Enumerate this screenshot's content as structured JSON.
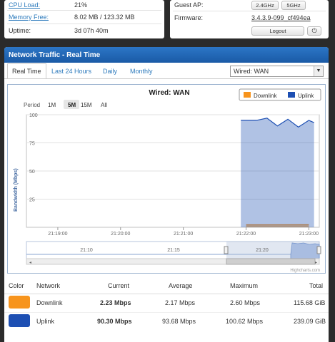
{
  "system": {
    "cpu_label": "CPU Load:",
    "cpu_value": "21%",
    "mem_label": "Memory Free:",
    "mem_value": "8.02 MB / 123.32 MB",
    "uptime_label": "Uptime:",
    "uptime_value": "3d 07h 40m"
  },
  "network": {
    "guest_label": "Guest AP:",
    "btn_24": "2.4GHz",
    "btn_5": "5GHz",
    "fw_label": "Firmware:",
    "fw_value": "3.4.3.9-099_cf494ea",
    "logout": "Logout",
    "power_icon": "⏻"
  },
  "traffic": {
    "title": "Network Traffic - Real Time",
    "tabs": [
      "Real Time",
      "Last 24 Hours",
      "Daily",
      "Monthly"
    ],
    "interface_selected": "Wired: WAN",
    "dropdown_arrow": "▼"
  },
  "chart_data": {
    "type": "area",
    "title": "Wired: WAN",
    "ylabel": "Bandwidth (Mbps)",
    "ylim": [
      0,
      100
    ],
    "yticks": [
      "100",
      "75",
      "50",
      "25"
    ],
    "xticks": [
      "21:19:00",
      "21:20:00",
      "21:21:00",
      "21:22:00",
      "21:23:00"
    ],
    "period_label": "Period",
    "periods": [
      "1M",
      "5M",
      "15M",
      "All"
    ],
    "period_selected": "5M",
    "legend": [
      "Downlink",
      "Uplink"
    ],
    "navigator_ticks": [
      "21:10",
      "21:15",
      "21:20"
    ],
    "credit": "Highcharts.com",
    "series": [
      {
        "name": "Downlink",
        "color": "#f7941d",
        "x": [
          "21:22:00",
          "21:23:00"
        ],
        "values": [
          2.2,
          2.3
        ]
      },
      {
        "name": "Uplink",
        "color": "#1d4fb3",
        "x": [
          "21:21:55",
          "21:22:10",
          "21:22:20",
          "21:22:30",
          "21:22:40",
          "21:22:50",
          "21:23:00",
          "21:23:05"
        ],
        "values": [
          95,
          95,
          97,
          90,
          96,
          89,
          95,
          93
        ]
      }
    ]
  },
  "table": {
    "headers": [
      "Color",
      "Network",
      "Current",
      "Average",
      "Maximum",
      "Total"
    ],
    "rows": [
      {
        "color": "#f7941d",
        "network": "Downlink",
        "current": "2.23 Mbps",
        "average": "2.17 Mbps",
        "maximum": "2.60 Mbps",
        "total": "115.68 GiB"
      },
      {
        "color": "#1d4fb3",
        "network": "Uplink",
        "current": "90.30 Mbps",
        "average": "93.68 Mbps",
        "maximum": "100.62 Mbps",
        "total": "239.09 GiB"
      }
    ]
  }
}
